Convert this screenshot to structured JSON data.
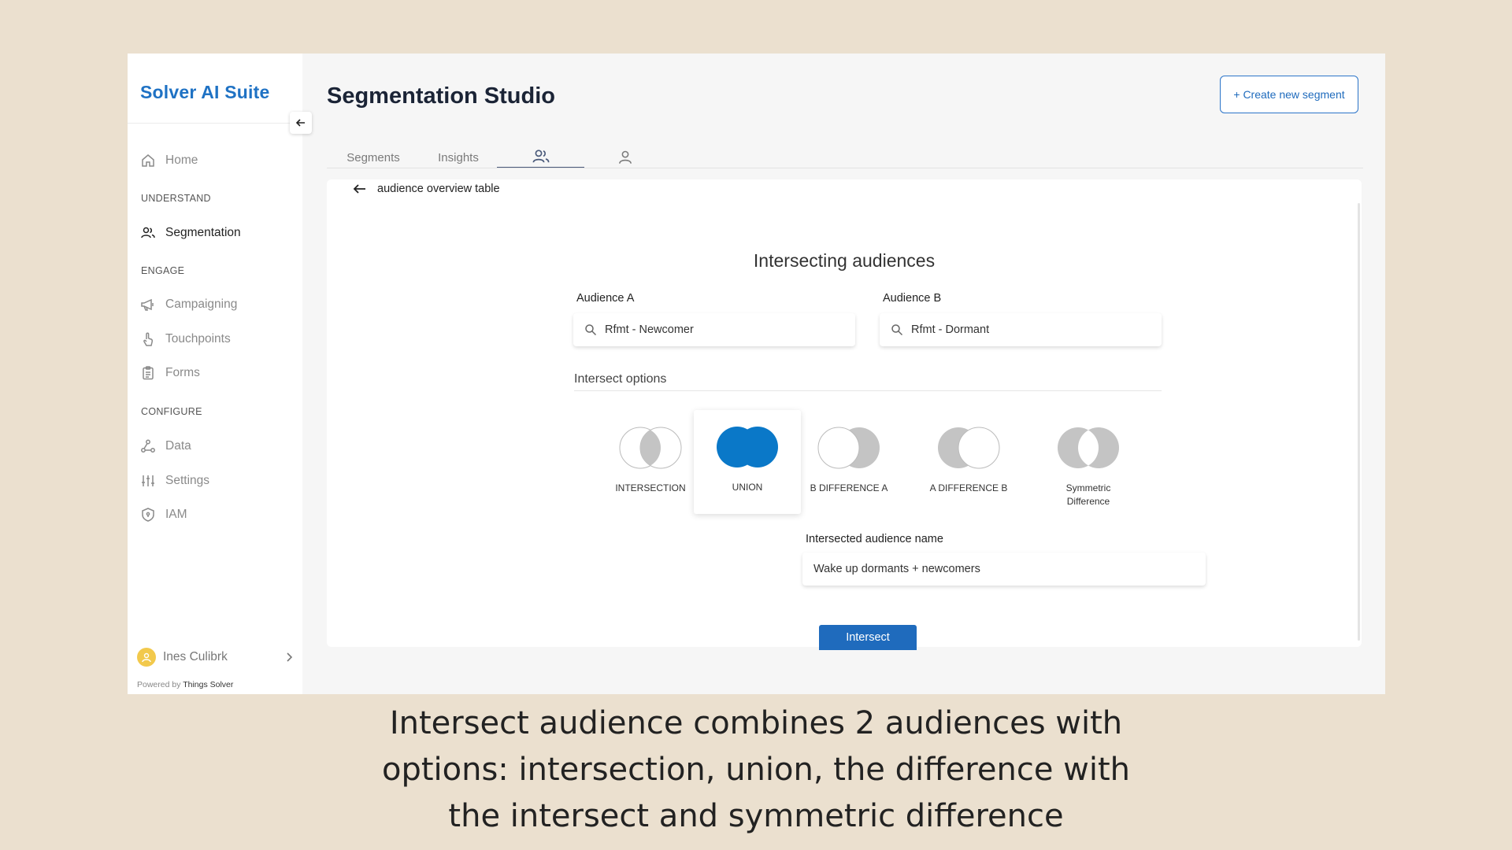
{
  "sidebar": {
    "brand": "Solver AI Suite",
    "items": {
      "home": "Home",
      "understand": "UNDERSTAND",
      "segmentation": "Segmentation",
      "engage": "ENGAGE",
      "campaigning": "Campaigning",
      "touchpoints": "Touchpoints",
      "forms": "Forms",
      "configure": "CONFIGURE",
      "data": "Data",
      "settings": "Settings",
      "iam": "IAM"
    },
    "user_name": "Ines Culibrk",
    "powered_prefix": "Powered by",
    "powered_brand": "Things Solver"
  },
  "header": {
    "title": "Segmentation Studio",
    "create_button": "+ Create new segment"
  },
  "tabs": {
    "segments": "Segments",
    "insights": "Insights",
    "audiences_icon": "users-icon",
    "user_icon": "user-icon"
  },
  "content": {
    "back_label": "audience overview table",
    "title": "Intersecting audiences",
    "audience_a": {
      "label": "Audience A",
      "value": "Rfmt - Newcomer"
    },
    "audience_b": {
      "label": "Audience B",
      "value": "Rfmt - Dormant"
    },
    "options_label": "Intersect options",
    "options": {
      "intersection": "INTERSECTION",
      "union": "UNION",
      "b_diff_a": "B DIFFERENCE A",
      "a_diff_b": "A DIFFERENCE B",
      "symmetric_1": "Symmetric",
      "symmetric_2": "Difference"
    },
    "selected_option": "UNION",
    "name_label": "Intersected audience name",
    "name_value": "Wake up dormants + newcomers",
    "intersect_button": "Intersect"
  },
  "caption": {
    "line1": "Intersect audience combines 2 audiences with",
    "line2": "options: intersection, union, the difference with",
    "line3": "the intersect and symmetric difference"
  },
  "colors": {
    "accent": "#1f6bbd",
    "brand": "#1f72c4",
    "venn_selected": "#0a78c8",
    "venn_gray": "#c4c4c4",
    "background": "#ebe0cf"
  }
}
